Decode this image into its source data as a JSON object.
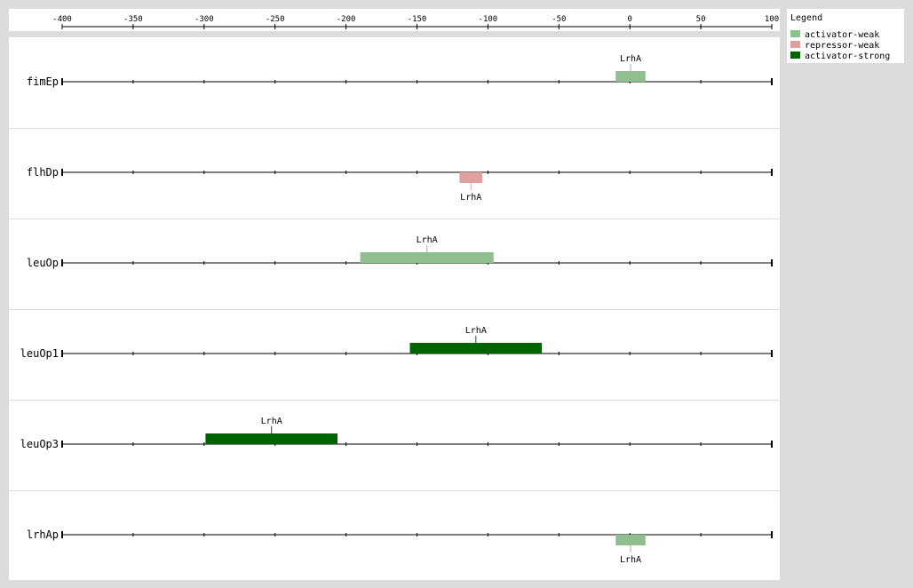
{
  "axis": {
    "ticks": [
      -400,
      -350,
      -300,
      -250,
      -200,
      -150,
      -100,
      -50,
      0,
      50,
      100
    ]
  },
  "legend": {
    "title": "Legend",
    "items": [
      {
        "label": "activator-weak",
        "color": "#8fbf8f"
      },
      {
        "label": "repressor-weak",
        "color": "#e0a0a0"
      },
      {
        "label": "activator-strong",
        "color": "#006400"
      }
    ]
  },
  "chart_data": {
    "type": "diagram",
    "xlim": [
      -400,
      100
    ],
    "tracks": [
      {
        "name": "fimEp",
        "sites": [
          {
            "label": "LrhA",
            "start": -10,
            "end": 11,
            "kind": "activator-weak",
            "strand": "top"
          }
        ]
      },
      {
        "name": "flhDp",
        "sites": [
          {
            "label": "LrhA",
            "start": -120,
            "end": -104,
            "kind": "repressor-weak",
            "strand": "bottom"
          }
        ]
      },
      {
        "name": "leuOp",
        "sites": [
          {
            "label": "LrhA",
            "start": -190,
            "end": -96,
            "kind": "activator-weak",
            "strand": "top"
          }
        ]
      },
      {
        "name": "leuOp1",
        "sites": [
          {
            "label": "LrhA",
            "start": -155,
            "end": -62,
            "kind": "activator-strong",
            "strand": "top"
          }
        ]
      },
      {
        "name": "leuOp3",
        "sites": [
          {
            "label": "LrhA",
            "start": -299,
            "end": -206,
            "kind": "activator-strong",
            "strand": "top"
          }
        ]
      },
      {
        "name": "lrhAp",
        "sites": [
          {
            "label": "LrhA",
            "start": -10,
            "end": 11,
            "kind": "activator-weak",
            "strand": "bottom"
          }
        ]
      }
    ]
  }
}
